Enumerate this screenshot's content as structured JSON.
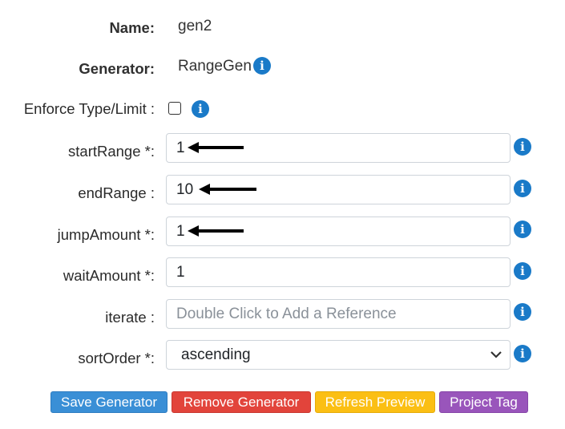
{
  "form": {
    "name": {
      "label": "Name:",
      "value": "gen2"
    },
    "generator": {
      "label": "Generator:",
      "value": "RangeGen"
    },
    "enforce": {
      "label": "Enforce Type/Limit :",
      "checked": false
    },
    "startRange": {
      "label": "startRange *:",
      "value": "1"
    },
    "endRange": {
      "label": "endRange :",
      "value": "10"
    },
    "jumpAmount": {
      "label": "jumpAmount *:",
      "value": "1"
    },
    "waitAmount": {
      "label": "waitAmount *:",
      "value": "1"
    },
    "iterate": {
      "label": "iterate :",
      "value": "",
      "placeholder": "Double Click to Add a Reference"
    },
    "sortOrder": {
      "label": "sortOrder *:",
      "value": "ascending"
    }
  },
  "info_icon_glyph": "i",
  "buttons": {
    "save": {
      "label": "Save Generator",
      "color": "#3a8fd6"
    },
    "remove": {
      "label": "Remove Generator",
      "color": "#e2443b"
    },
    "refresh": {
      "label": "Refresh Preview",
      "color": "#fbbf14"
    },
    "tag": {
      "label": "Project Tag",
      "color": "#9955bb"
    }
  },
  "colors": {
    "info": "#1a7ac8"
  }
}
